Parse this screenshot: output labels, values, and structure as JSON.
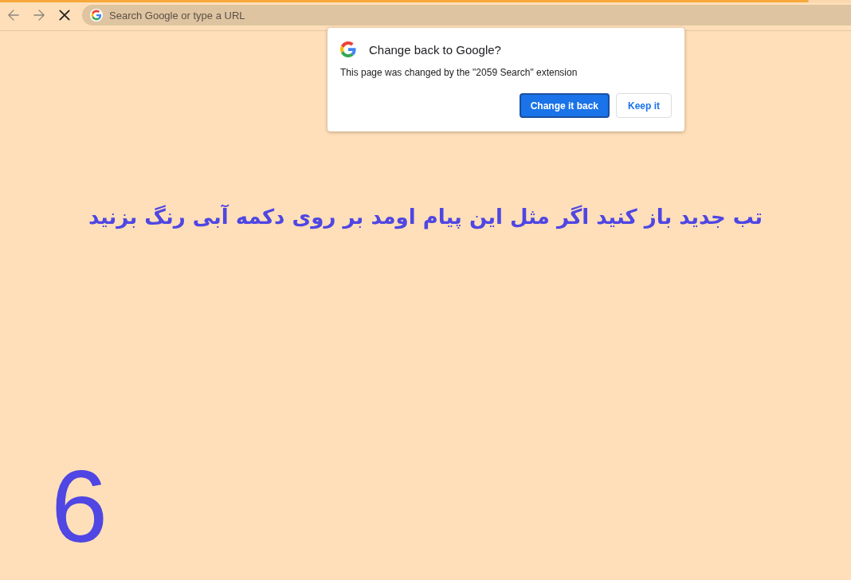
{
  "toolbar": {
    "loading": {
      "level": 0.95
    },
    "nav_buttons": [
      {
        "kind": "back",
        "disabled": true
      },
      {
        "kind": "forward",
        "disabled": true
      },
      {
        "kind": "stop",
        "disabled": false
      }
    ],
    "omnibox": {
      "placeholder": "Search Google or type a URL"
    }
  },
  "popup": {
    "title": "Change back to Google?",
    "message": "This page was changed by the \"2059 Search\" extension",
    "buttons": [
      {
        "label": "Change it back",
        "kind": "primary",
        "focused": true
      },
      {
        "label": "Keep it",
        "kind": "secondary",
        "focused": false
      }
    ]
  },
  "page": {
    "heading": "تب جدید باز کنید اگر مثل این پیام اومد بر روی دکمه آبی رنگ بزنید",
    "number": "6"
  }
}
